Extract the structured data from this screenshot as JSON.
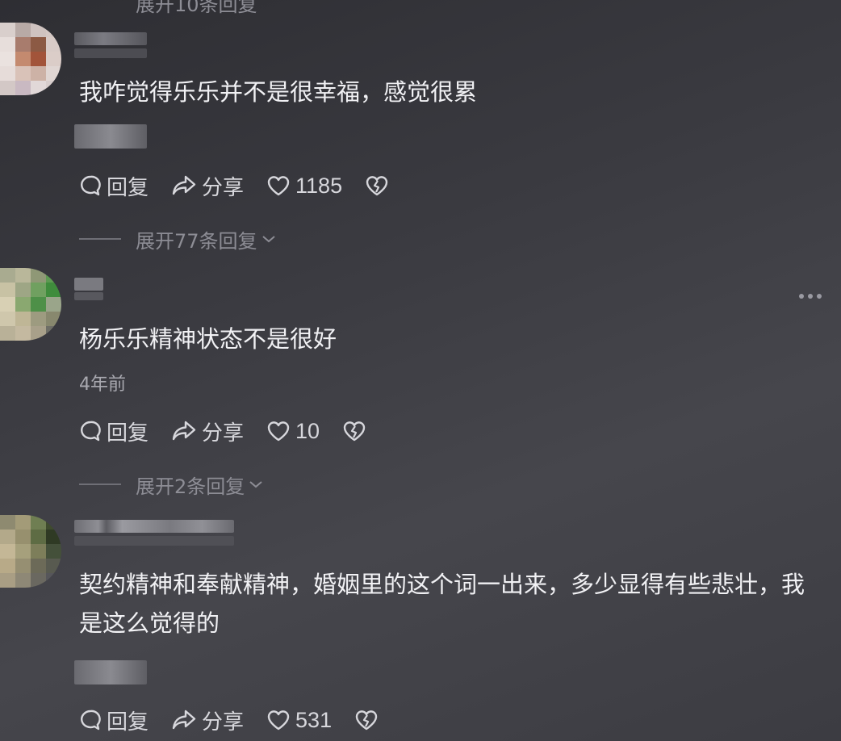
{
  "top_partial_text": "展开10条回复",
  "comments": [
    {
      "text": "我咋觉得乐乐并不是很幸福，感觉很累",
      "time": "",
      "actions": {
        "reply": "回复",
        "share": "分享",
        "likes": "1185"
      },
      "expand_label": "展开77条回复"
    },
    {
      "text": "杨乐乐精神状态不是很好",
      "time": "4年前",
      "actions": {
        "reply": "回复",
        "share": "分享",
        "likes": "10"
      },
      "expand_label": "展开2条回复"
    },
    {
      "text": "契约精神和奉献精神，婚姻里的这个词一出来，多少显得有些悲壮，我是这么觉得的",
      "time": "",
      "actions": {
        "reply": "回复",
        "share": "分享",
        "likes": "531"
      }
    }
  ],
  "colors": {
    "background": "#3a3a40",
    "text": "#f1f1f4",
    "muted": "#8d8d95"
  },
  "icons": [
    "comment-bubble-icon",
    "share-arrow-icon",
    "heart-icon",
    "broken-heart-icon",
    "chevron-down-icon",
    "more-dots-icon"
  ]
}
